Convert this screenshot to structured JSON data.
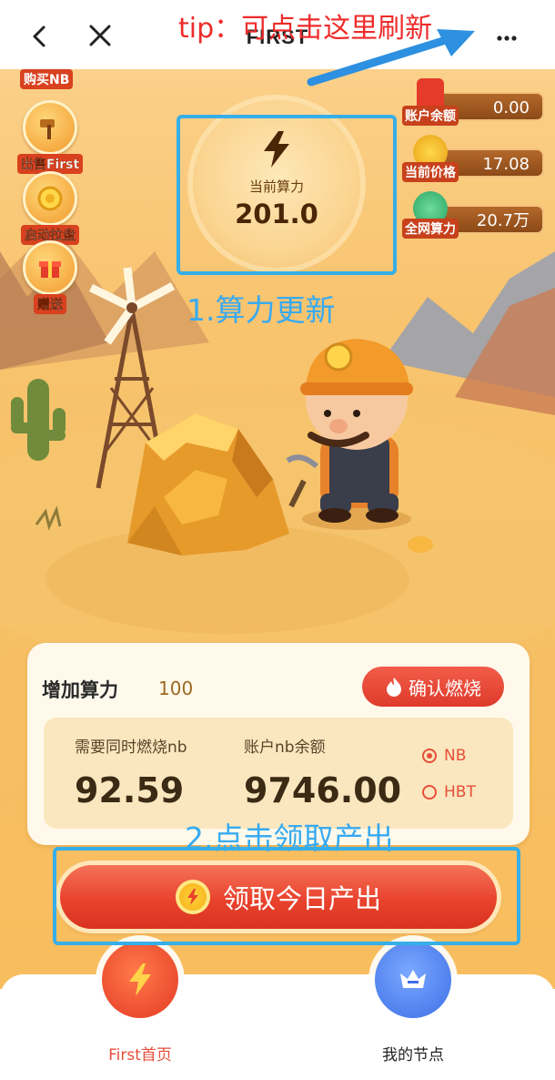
{
  "header": {
    "title": "FIRST",
    "tip": "tip：可点击这里刷新"
  },
  "side_actions": [
    {
      "label": "购买NB",
      "icon": "nb-icon"
    },
    {
      "label": "出售First",
      "icon": "hammer-icon"
    },
    {
      "label": "启动拉盘",
      "icon": "coin-icon"
    },
    {
      "label": "赠送",
      "icon": "gift-icon"
    }
  ],
  "stats": [
    {
      "label": "账户余额",
      "value": "0.00",
      "icon": "envelope-icon"
    },
    {
      "label": "当前价格",
      "value": "17.08",
      "icon": "coin-icon"
    },
    {
      "label": "全网算力",
      "value": "20.7万",
      "icon": "arrow-up-icon"
    }
  ],
  "power": {
    "label": "当前算力",
    "value": "201.0",
    "annotation": "1.算力更新"
  },
  "burn_card": {
    "increase_label": "增加算力",
    "increase_value": "100",
    "confirm_label": "确认燃烧",
    "need_label": "需要同时燃烧nb",
    "need_value": "92.59",
    "balance_label": "账户nb余额",
    "balance_value": "9746.00",
    "options": [
      {
        "label": "NB",
        "selected": true
      },
      {
        "label": "HBT",
        "selected": false
      }
    ]
  },
  "claim": {
    "label": "领取今日产出",
    "annotation": "2.点击领取产出"
  },
  "nav": [
    {
      "label": "First首页",
      "active": true
    },
    {
      "label": "我的节点",
      "active": false
    }
  ],
  "colors": {
    "accent_red": "#e9432e",
    "highlight_blue": "#36aee8",
    "tip_red": "#ee2b2b"
  }
}
